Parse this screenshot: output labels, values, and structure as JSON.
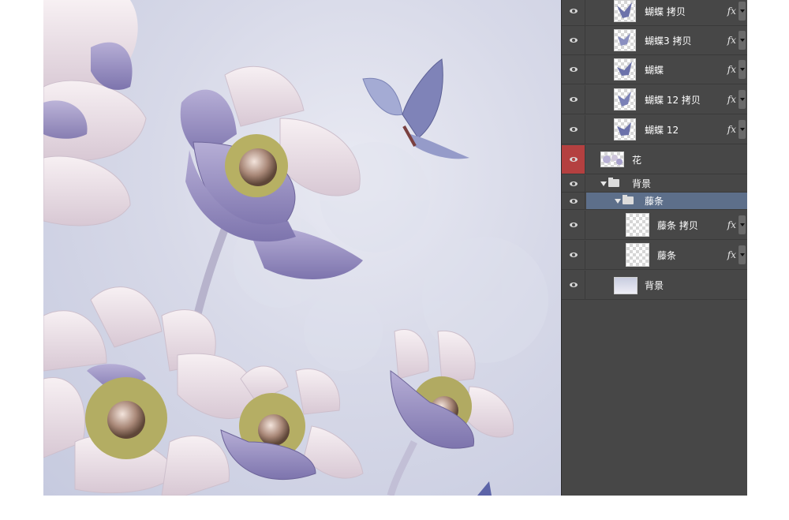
{
  "layers_panel": {
    "layers": [
      {
        "name": "蝴蝶 拷贝",
        "fx": "fx",
        "thumb": "butterfly"
      },
      {
        "name": "蝴蝶3 拷贝",
        "fx": "fx",
        "thumb": "butterfly"
      },
      {
        "name": "蝴蝶",
        "fx": "fx",
        "thumb": "butterfly"
      },
      {
        "name": "蝴蝶 12 拷贝",
        "fx": "fx",
        "thumb": "butterfly"
      },
      {
        "name": "蝴蝶 12",
        "fx": "fx",
        "thumb": "butterfly"
      },
      {
        "name": "花",
        "fx": "",
        "thumb": "flowers",
        "eye_highlight": "#b44040"
      },
      {
        "name": "背景",
        "type": "group",
        "expanded": true
      },
      {
        "name": "藤条",
        "type": "group",
        "expanded": true,
        "selected": true
      },
      {
        "name": "藤条 拷贝",
        "fx": "fx",
        "thumb": "transparent"
      },
      {
        "name": "藤条",
        "fx": "fx",
        "thumb": "transparent"
      },
      {
        "name": "背景",
        "fx": "",
        "thumb": "gradient"
      }
    ]
  },
  "colors": {
    "panel_bg": "#474747",
    "selected_row": "#5d6f8a",
    "eye_highlight": "#b44040",
    "canvas_bg": "#d7d9e8",
    "petal_lavender": "#9d96c4",
    "petal_pink": "#eadfe6"
  },
  "icons": [
    "eye-icon",
    "folder-icon",
    "disclosure-triangle-icon",
    "fx-icon"
  ]
}
